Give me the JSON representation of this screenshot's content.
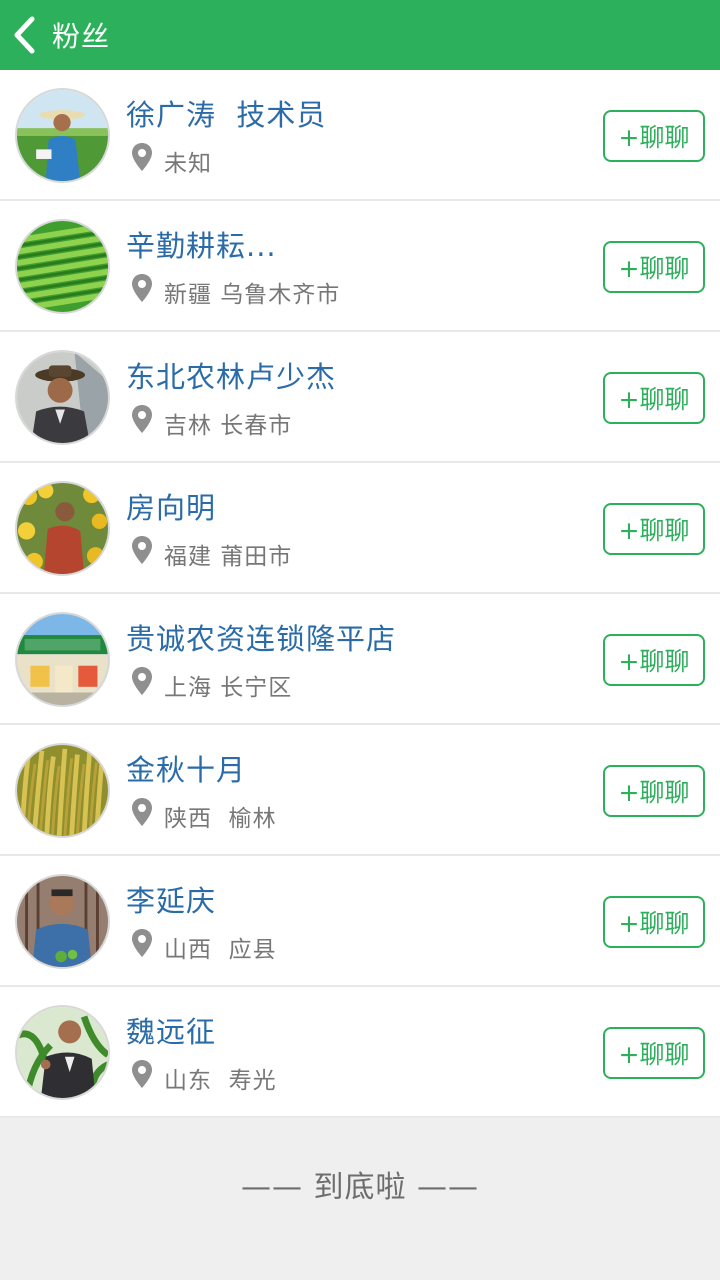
{
  "header": {
    "title": "粉丝",
    "back_icon": "chevron-left-icon"
  },
  "accent_color": "#2db05b",
  "name_color": "#2b6ca8",
  "fans": [
    {
      "name": "徐广涛  技术员",
      "location": "未知",
      "chat_label": "+聊聊"
    },
    {
      "name": "辛勤耕耘...",
      "location": "新疆 乌鲁木齐市",
      "chat_label": "+聊聊"
    },
    {
      "name": "东北农林卢少杰",
      "location": "吉林 长春市",
      "chat_label": "+聊聊"
    },
    {
      "name": "房向明",
      "location": "福建 莆田市",
      "chat_label": "+聊聊"
    },
    {
      "name": "贵诚农资连锁隆平店",
      "location": "上海 长宁区",
      "chat_label": "+聊聊"
    },
    {
      "name": "金秋十月",
      "location": "陕西  榆林",
      "chat_label": "+聊聊"
    },
    {
      "name": "李延庆",
      "location": "山西  应县",
      "chat_label": "+聊聊"
    },
    {
      "name": "魏远征",
      "location": "山东  寿光",
      "chat_label": "+聊聊"
    }
  ],
  "footer": {
    "end_text": "—— 到底啦 ——"
  }
}
